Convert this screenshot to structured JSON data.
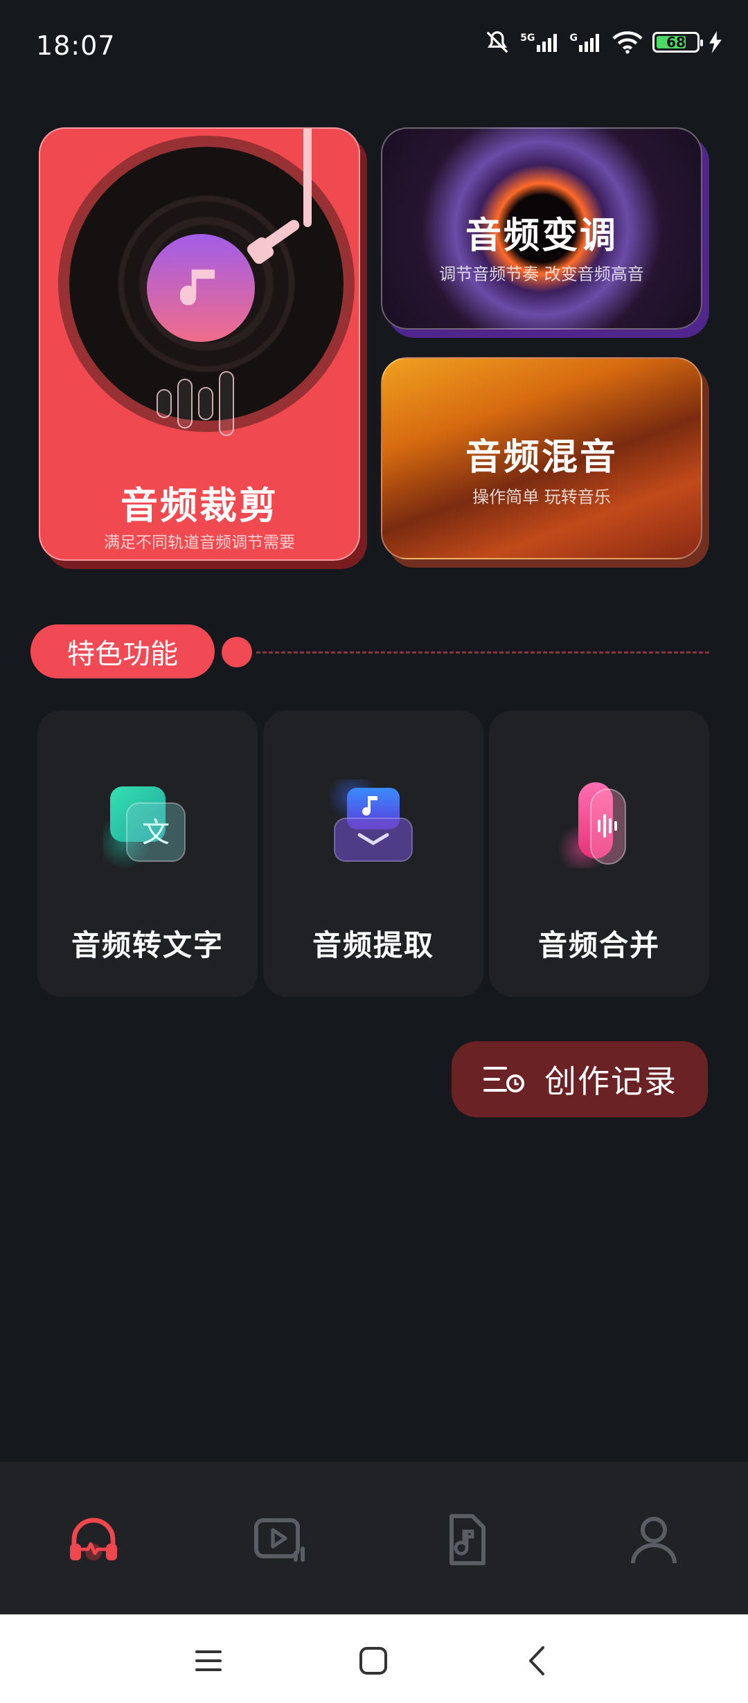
{
  "status_bar": {
    "time": "18:07",
    "network_1": "5G",
    "network_2": "G",
    "battery": "68"
  },
  "feature_cards": {
    "cut": {
      "title": "音频裁剪",
      "subtitle": "满足不同轨道音频调节需要"
    },
    "pitch": {
      "title": "音频变调",
      "subtitle": "调节音频节奏 改变音频高音"
    },
    "mix": {
      "title": "音频混音",
      "subtitle": "操作简单 玩转音乐"
    }
  },
  "section": {
    "title": "特色功能"
  },
  "tools": [
    {
      "label": "音频转文字",
      "icon_char": "文"
    },
    {
      "label": "音频提取"
    },
    {
      "label": "音频合并"
    }
  ],
  "history_button": {
    "label": "创作记录"
  },
  "tabbar": {
    "active_color": "#f0474f",
    "inactive_color": "#5a5d63",
    "tabs": [
      "headphones-icon",
      "video-audio-icon",
      "music-file-icon",
      "profile-icon"
    ]
  },
  "colors": {
    "background": "#15181c",
    "accent": "#f24a54"
  }
}
